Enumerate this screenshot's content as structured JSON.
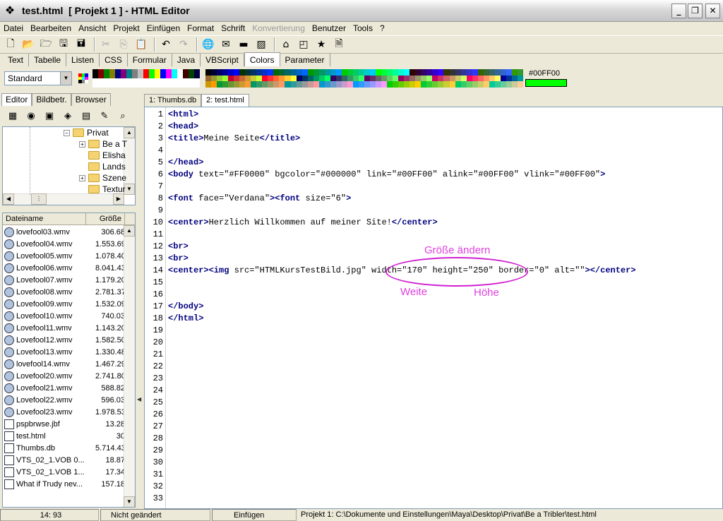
{
  "window": {
    "title": "test.html  [ Projekt 1 ] - HTML Editor",
    "minimize": "_",
    "maximize": "❐",
    "close": "✕"
  },
  "menu": [
    {
      "label": "Datei"
    },
    {
      "label": "Bearbeiten"
    },
    {
      "label": "Ansicht"
    },
    {
      "label": "Projekt"
    },
    {
      "label": "Einfügen"
    },
    {
      "label": "Format"
    },
    {
      "label": "Schrift"
    },
    {
      "label": "Konvertierung",
      "disabled": true
    },
    {
      "label": "Benutzer"
    },
    {
      "label": "Tools"
    },
    {
      "label": "?"
    }
  ],
  "toolbar_icons": [
    "new-file-icon",
    "open-icon",
    "open-project-icon",
    "save-icon",
    "save-all-icon",
    "cut-icon",
    "copy-icon",
    "paste-icon",
    "undo-icon",
    "redo-icon",
    "globe-icon",
    "mail-icon",
    "horizontal-rule-icon",
    "image-icon",
    "home-icon",
    "preview-icon",
    "bookmark-icon",
    "page-icon"
  ],
  "tag_tabs": [
    "Text",
    "Tabelle",
    "Listen",
    "CSS",
    "Formular",
    "Java",
    "VBScript",
    "Colors",
    "Parameter"
  ],
  "tag_tabs_active": "Colors",
  "colors": {
    "style_select": "Standard",
    "current_code": "#00FF00",
    "current_color": "#00FF00"
  },
  "left_tabs": [
    "Editor",
    "Bildbetr.",
    "Browser"
  ],
  "doc_tabs": [
    "1: Thumbs.db",
    "2: test.html"
  ],
  "tree": [
    {
      "label": "Privat",
      "expander": "−"
    },
    {
      "label": "Be a T",
      "expander": "+"
    },
    {
      "label": "Elisha",
      "expander": ""
    },
    {
      "label": "Lands",
      "expander": ""
    },
    {
      "label": "Szene",
      "expander": "+"
    },
    {
      "label": "Textur",
      "expander": ""
    }
  ],
  "filelist": {
    "col_name": "Dateiname",
    "col_size": "Größe",
    "rows": [
      {
        "name": "lovefool03.wmv",
        "size": "306.68"
      },
      {
        "name": "Lovefool04.wmv",
        "size": "1.553.69"
      },
      {
        "name": "Lovefool05.wmv",
        "size": "1.078.40"
      },
      {
        "name": "Lovefool06.wmv",
        "size": "8.041.43"
      },
      {
        "name": "Lovefool07.wmv",
        "size": "1.179.20"
      },
      {
        "name": "Lovefool08.wmv",
        "size": "2.781.37"
      },
      {
        "name": "Lovefool09.wmv",
        "size": "1.532.09"
      },
      {
        "name": "Lovefool10.wmv",
        "size": "740.03"
      },
      {
        "name": "Lovefool11.wmv",
        "size": "1.143.20"
      },
      {
        "name": "Lovefool12.wmv",
        "size": "1.582.50"
      },
      {
        "name": "Lovefool13.wmv",
        "size": "1.330.48"
      },
      {
        "name": "lovefool14.wmv",
        "size": "1.467.29"
      },
      {
        "name": "Lovefool20.wmv",
        "size": "2.741.80"
      },
      {
        "name": "Lovefool21.wmv",
        "size": "588.82"
      },
      {
        "name": "Lovefool22.wmv",
        "size": "596.03"
      },
      {
        "name": "Lovefool23.wmv",
        "size": "1.978.53"
      },
      {
        "name": "pspbrwse.jbf",
        "size": "13.28"
      },
      {
        "name": "test.html",
        "size": "30"
      },
      {
        "name": "Thumbs.db",
        "size": "5.714.43"
      },
      {
        "name": "VTS_02_1.VOB 0...",
        "size": "18.87"
      },
      {
        "name": "VTS_02_1.VOB 1...",
        "size": "17.34"
      },
      {
        "name": "What if Trudy nev...",
        "size": "157.18"
      }
    ]
  },
  "code_lines": [
    [
      [
        "tag",
        "<html>"
      ]
    ],
    [
      [
        "tag",
        "<head>"
      ]
    ],
    [
      [
        "tag",
        "<title>"
      ],
      [
        "txt",
        "Meine Seite"
      ],
      [
        "tag",
        "</title>"
      ]
    ],
    [],
    [
      [
        "tag",
        "</head>"
      ]
    ],
    [
      [
        "tag",
        "<body"
      ],
      [
        "txt",
        " text=\"#FF0000\" bgcolor=\"#000000\" link=\"#00FF00\" alink=\"#00FF00\" vlink=\"#00FF00\""
      ],
      [
        "tag",
        ">"
      ]
    ],
    [],
    [
      [
        "tag",
        "<font"
      ],
      [
        "txt",
        " face=\"Verdana\""
      ],
      [
        "tag",
        "><font"
      ],
      [
        "txt",
        " size=\"6\""
      ],
      [
        "tag",
        ">"
      ]
    ],
    [],
    [
      [
        "tag",
        "<center>"
      ],
      [
        "txt",
        "Herzlich Willkommen auf meiner Site!"
      ],
      [
        "tag",
        "</center>"
      ]
    ],
    [],
    [
      [
        "tag",
        "<br>"
      ]
    ],
    [
      [
        "tag",
        "<br>"
      ]
    ],
    [
      [
        "tag",
        "<center><img"
      ],
      [
        "txt",
        " src=\"HTMLKursTestBild.jpg\" width=\"170\" height=\"250\" border=\"0\" alt=\"\""
      ],
      [
        "tag",
        "></center>"
      ]
    ],
    [],
    [],
    [
      [
        "tag",
        "</body>"
      ]
    ],
    [
      [
        "tag",
        "</html>"
      ]
    ]
  ],
  "line_count": 33,
  "annotations": {
    "top": "Größe ändern",
    "left": "Weite",
    "right": "Höhe"
  },
  "status": {
    "position": "14: 93",
    "modified": "Nicht geändert",
    "mode": "Einfügen",
    "path": "Projekt 1: C:\\Dokumente und Einstellungen\\Maya\\Desktop\\Privat\\Be a Tribler\\test.html"
  }
}
